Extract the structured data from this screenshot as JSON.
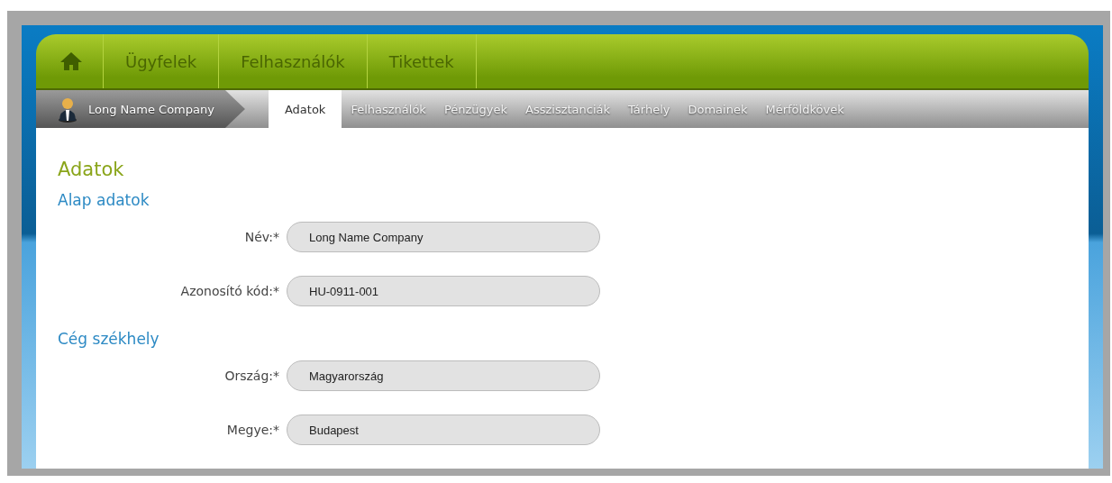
{
  "main_nav": [
    {
      "kind": "home",
      "selected": false
    },
    {
      "kind": "text",
      "label": "Ügyfelek",
      "selected": false
    },
    {
      "kind": "text",
      "label": "Felhasználók",
      "selected": false
    },
    {
      "kind": "text",
      "label": "Tikettek",
      "selected": false
    }
  ],
  "breadcrumb": {
    "company": "Long Name Company"
  },
  "tabs": [
    {
      "label": "Adatok",
      "selected": true
    },
    {
      "label": "Felhasználók",
      "selected": false
    },
    {
      "label": "Pénzügyek",
      "selected": false
    },
    {
      "label": "Asszisztanciák",
      "selected": false
    },
    {
      "label": "Tárhely",
      "selected": false
    },
    {
      "label": "Domainek",
      "selected": false
    },
    {
      "label": "Mérföldkövek",
      "selected": false
    }
  ],
  "page_title": "Adatok",
  "sections": [
    {
      "title": "Alap adatok",
      "fields": [
        {
          "label": "Név:*",
          "value": "Long Name Company"
        },
        {
          "label": "Azonosító kód:*",
          "value": "HU-0911-001"
        }
      ]
    },
    {
      "title": "Cég székhely",
      "fields": [
        {
          "label": "Ország:*",
          "value": "Magyarország"
        },
        {
          "label": "Megye:*",
          "value": "Budapest"
        }
      ]
    }
  ]
}
